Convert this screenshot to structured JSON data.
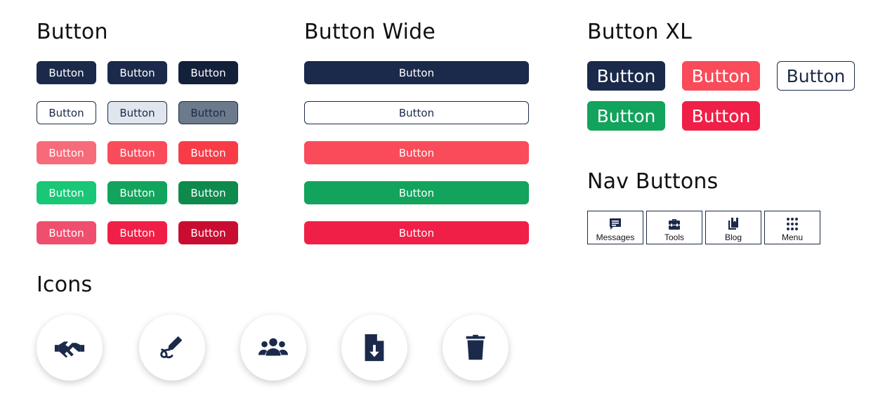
{
  "headings": {
    "button": "Button",
    "button_wide": "Button Wide",
    "button_xl": "Button XL",
    "nav_buttons": "Nav Buttons",
    "icons": "Icons"
  },
  "button_label": "Button",
  "colors": {
    "navy": "#1b2a4a",
    "navy_dark": "#13203a",
    "light_blue_gray": "#e1e5ee",
    "slate": "#6c7a8c",
    "coral_light": "#f76a7a",
    "coral": "#f94b5a",
    "red": "#f73c48",
    "green_light": "#19c777",
    "green": "#12a35c",
    "green_dark": "#0e8a4c",
    "crimson_light": "#f04e6e",
    "crimson": "#f01f47",
    "crimson_dark": "#c90d32"
  },
  "nav_buttons": [
    {
      "label": "Messages",
      "icon": "message-icon"
    },
    {
      "label": "Tools",
      "icon": "toolbox-icon"
    },
    {
      "label": "Blog",
      "icon": "book-icon"
    },
    {
      "label": "Menu",
      "icon": "grid-dots-icon"
    }
  ],
  "icons": [
    "handshake-icon",
    "signature-icon",
    "users-icon",
    "file-download-icon",
    "trash-icon"
  ]
}
